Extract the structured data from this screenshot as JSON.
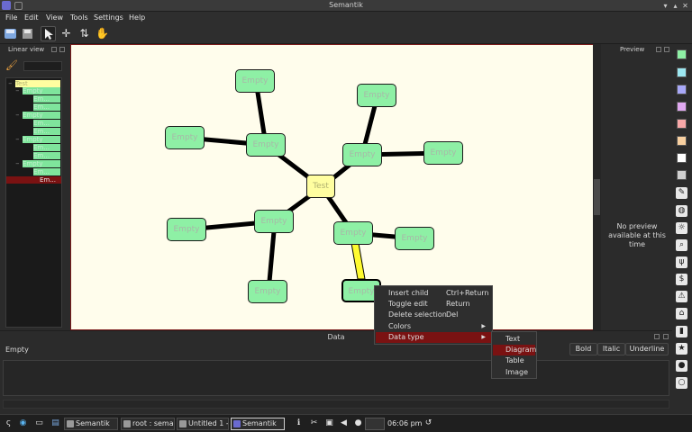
{
  "window": {
    "title": "Semantik"
  },
  "menubar": [
    "File",
    "Edit",
    "View",
    "Tools",
    "Settings",
    "Help"
  ],
  "toolbar": {
    "tools": [
      "save-icon",
      "print-icon",
      "select-pointer-icon",
      "move-icon",
      "sort-icon",
      "hand-icon"
    ]
  },
  "linear_view": {
    "title": "Linear view",
    "tree": [
      {
        "label": "Test",
        "level": 0,
        "style": "root"
      },
      {
        "label": "Empty",
        "level": 1,
        "style": "green"
      },
      {
        "label": "Em...",
        "level": 2,
        "style": "green"
      },
      {
        "label": "Em...",
        "level": 2,
        "style": "green"
      },
      {
        "label": "Empty",
        "level": 1,
        "style": "green"
      },
      {
        "label": "Em...",
        "level": 2,
        "style": "green"
      },
      {
        "label": "Em...",
        "level": 2,
        "style": "green"
      },
      {
        "label": "Empty",
        "level": 1,
        "style": "green"
      },
      {
        "label": "Em...",
        "level": 2,
        "style": "green"
      },
      {
        "label": "Em...",
        "level": 2,
        "style": "green"
      },
      {
        "label": "Empty",
        "level": 1,
        "style": "green"
      },
      {
        "label": "Em...",
        "level": 2,
        "style": "green"
      },
      {
        "label": "Em...",
        "level": 2,
        "style": "selected"
      }
    ]
  },
  "mindmap": {
    "root": {
      "label": "Test"
    },
    "nodes": [
      {
        "label": "Empty"
      },
      {
        "label": "Empty"
      },
      {
        "label": "Empty"
      },
      {
        "label": "Empty"
      },
      {
        "label": "Empty"
      },
      {
        "label": "Empty"
      },
      {
        "label": "Empty"
      },
      {
        "label": "Empty"
      },
      {
        "label": "Empty"
      },
      {
        "label": "Empty"
      },
      {
        "label": "Empty"
      },
      {
        "label": "Empty"
      }
    ]
  },
  "preview": {
    "title": "Preview",
    "message": "No preview available at this time"
  },
  "palette": {
    "colors": [
      "#8ef0a5",
      "#9ce7f0",
      "#a8a8f8",
      "#e0a8f0",
      "#f8a8a8",
      "#f8d0a0",
      "#ffffff",
      "#d0d0d0"
    ],
    "icons": [
      "brush-icon",
      "globe-icon",
      "bulb-icon",
      "magnifier-icon",
      "cutlery-icon",
      "dollar-icon",
      "warning-icon",
      "home-icon",
      "bottle-icon",
      "star-icon",
      "ball-icon",
      "ring-icon"
    ]
  },
  "data_dock": {
    "title": "Data",
    "summary": "Empty",
    "buttons": {
      "bold": "Bold",
      "italic": "Italic",
      "underline": "Underline"
    }
  },
  "context_menu": {
    "items": [
      {
        "label": "Insert child",
        "shortcut": "Ctrl+Return"
      },
      {
        "label": "Toggle edit",
        "shortcut": "Return"
      },
      {
        "label": "Delete selection",
        "shortcut": "Del"
      },
      {
        "label": "Colors",
        "shortcut": ""
      },
      {
        "label": "Data type",
        "shortcut": ""
      }
    ],
    "submenu": [
      "Text",
      "Diagram",
      "Table",
      "Image"
    ]
  },
  "taskbar": {
    "tasks": [
      "Semantik",
      "root : seman",
      "Untitled 1 -",
      "Semantik"
    ],
    "clock": "06:06 pm"
  }
}
